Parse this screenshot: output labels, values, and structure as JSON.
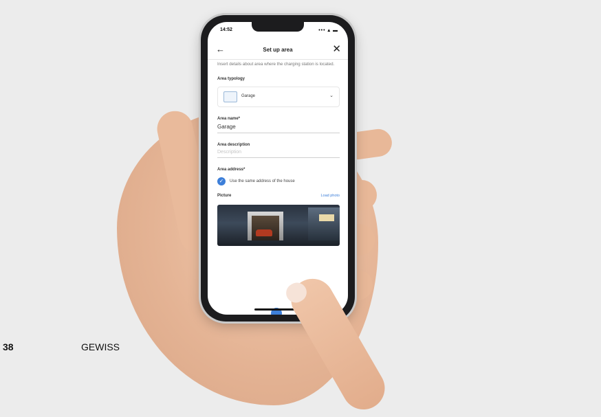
{
  "status_bar": {
    "time": "14:52",
    "icons": "••• ▴ ▬"
  },
  "app_bar": {
    "back_icon": "←",
    "title": "Set up area",
    "close_icon": "✕"
  },
  "form": {
    "intro_text": "Insert details about area where the charging station is located.",
    "area_typology": {
      "label": "Area typology",
      "value": "Garage",
      "chevron": "⌄"
    },
    "area_name": {
      "label": "Area name*",
      "value": "Garage"
    },
    "area_description": {
      "label": "Area description",
      "placeholder": "Description"
    },
    "area_address": {
      "label": "Area address*",
      "checkbox_label": "Use the same address of the house",
      "checked": true,
      "check_glyph": "✓"
    },
    "picture": {
      "label": "Picture",
      "link": "Load photo"
    }
  },
  "footer": {
    "page_number": "38",
    "brand": "GEWISS"
  },
  "colors": {
    "accent": "#3d7fd9",
    "background": "#ececec",
    "phone_body": "#1c1c1e"
  }
}
